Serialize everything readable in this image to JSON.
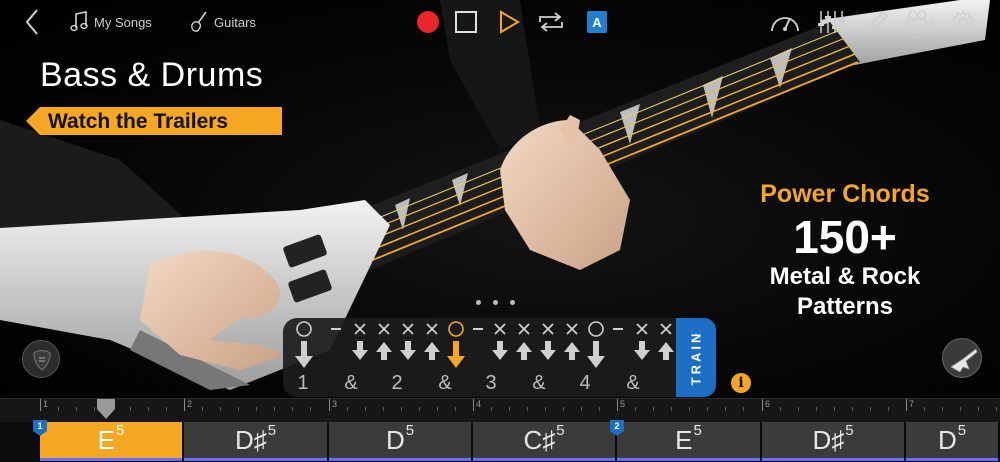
{
  "toolbar": {
    "my_songs_label": "My Songs",
    "guitars_label": "Guitars",
    "a_badge": "A"
  },
  "promo": {
    "title": "Bass & Drums",
    "trailer_button": "Watch the Trailers",
    "subtitle": "Power Chords",
    "count": "150+",
    "line1": "Metal & Rock",
    "line2": "Patterns"
  },
  "strum": {
    "train_label": "TRAIN",
    "info_icon": "i",
    "beats": [
      "1",
      "&",
      "2",
      "&",
      "3",
      "&",
      "4",
      "&"
    ]
  },
  "timeline": {
    "bars": [
      "1",
      "2",
      "3",
      "4",
      "5",
      "6",
      "7"
    ],
    "chords": [
      {
        "root": "E",
        "sup": "5"
      },
      {
        "root": "D♯",
        "sup": "5"
      },
      {
        "root": "D",
        "sup": "5"
      },
      {
        "root": "C♯",
        "sup": "5"
      },
      {
        "root": "E",
        "sup": "5"
      },
      {
        "root": "D♯",
        "sup": "5"
      },
      {
        "root": "D",
        "sup": "5"
      }
    ],
    "sections": [
      "1",
      "2"
    ]
  },
  "colors": {
    "accent": "#f5a623",
    "record": "#e8262c",
    "train": "#1d6fc6",
    "badge": "#1f7fd0"
  }
}
